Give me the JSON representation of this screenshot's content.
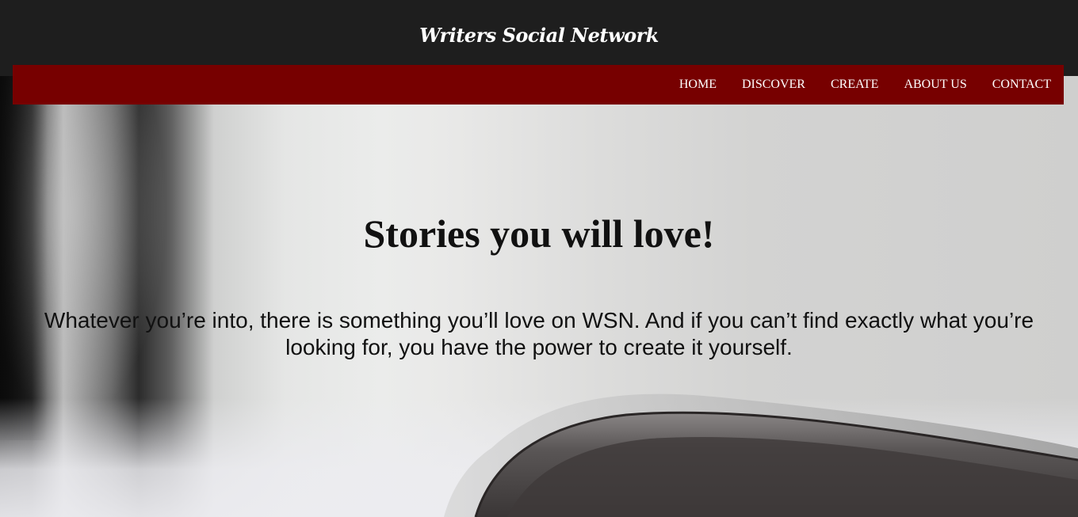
{
  "header": {
    "brand": "Writers Social Network"
  },
  "nav": {
    "items": [
      {
        "label": "HOME"
      },
      {
        "label": "DISCOVER"
      },
      {
        "label": "CREATE"
      },
      {
        "label": "ABOUT US"
      },
      {
        "label": "CONTACT"
      }
    ]
  },
  "hero": {
    "title": "Stories you will love!",
    "text": "Whatever you’re into, there is something you’ll love on WSN. And if you can’t find exactly what you’re looking for, you have the power to create it yourself."
  },
  "colors": {
    "header_bg": "#1e1e1e",
    "nav_bg": "#770000",
    "nav_text": "#ffffff",
    "hero_text": "#111111"
  }
}
